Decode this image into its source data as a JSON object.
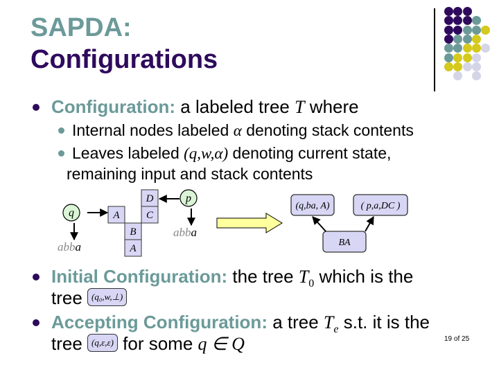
{
  "slide": {
    "title_line1": "SAPDA:",
    "title_line2": "Configurations",
    "page_number": "19 of 25"
  },
  "colors": {
    "teal": "#6b9a99",
    "purple": "#2e0a5c",
    "yellow": "#d4c91c",
    "lavender": "#d5d5e8",
    "node_fill": "#d7d6f4",
    "state_fill": "#d9f5d5",
    "arrow_fill": "#ffff9e"
  },
  "bullets": [
    {
      "label": "Configuration:",
      "text": " a labeled tree ",
      "math": "T",
      "text_after": " where",
      "sub_bullets": [
        {
          "text_before": "Internal nodes labeled ",
          "math": "α",
          "text_after": " denoting stack contents"
        },
        {
          "text_before": "Leaves labeled ",
          "math": "(q,w,α)",
          "text_after": " denoting current state,",
          "line2": "remaining input and stack contents"
        }
      ]
    },
    {
      "label": "Initial Configuration:",
      "text": " the tree ",
      "math": "T",
      "math_sub": "0",
      "text_after": " which is the",
      "line2_prefix": "tree ",
      "box_math": "(q₀,w,⊥)"
    },
    {
      "label": "Accepting Configuration:",
      "text": " a tree ",
      "math": "T",
      "math_sub": "e",
      "text_after": " s.t. it is the",
      "line2_prefix": "tree ",
      "box_math": "(q,ε,ε)",
      "line2_after": " for some ",
      "line2_math": "q ∈ Q"
    }
  ],
  "diagram_left": {
    "states": [
      {
        "label": "q",
        "input": "abba"
      },
      {
        "label": "p",
        "input": "abba"
      }
    ],
    "stack_cells": [
      "A",
      "B",
      "A",
      "D",
      "C"
    ]
  },
  "diagram_right": {
    "leaves": [
      "(q,ba, A)",
      "( p,a,DC )"
    ],
    "root": "BA"
  }
}
